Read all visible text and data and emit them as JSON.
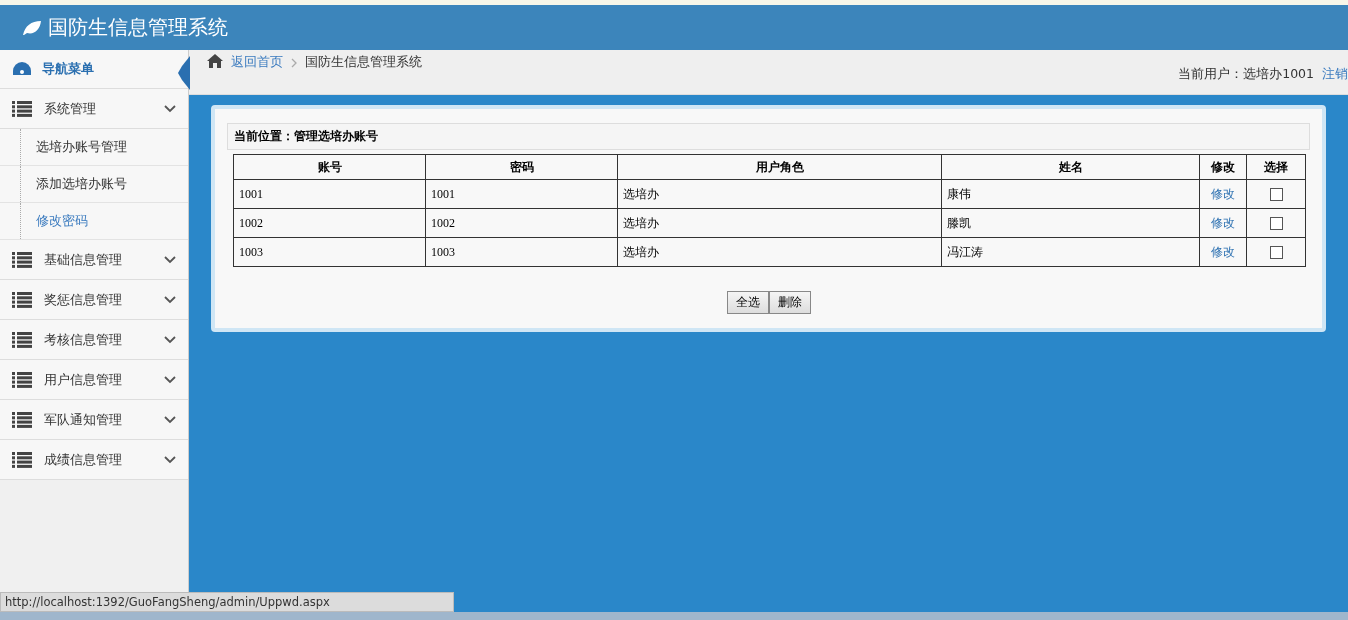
{
  "header": {
    "title": "国防生信息管理系统"
  },
  "sidebar": {
    "title": "导航菜单",
    "groups": [
      {
        "label": "系统管理",
        "children": [
          {
            "label": "选培办账号管理",
            "selected": false
          },
          {
            "label": "添加选培办账号",
            "selected": false
          },
          {
            "label": "修改密码",
            "selected": true
          }
        ]
      },
      {
        "label": "基础信息管理"
      },
      {
        "label": "奖惩信息管理"
      },
      {
        "label": "考核信息管理"
      },
      {
        "label": "用户信息管理"
      },
      {
        "label": "军队通知管理"
      },
      {
        "label": "成绩信息管理"
      }
    ]
  },
  "breadcrumb": {
    "home_link": "返回首页",
    "current": "国防生信息管理系统"
  },
  "user": {
    "label": "当前用户：选培办1001",
    "logout": "注销"
  },
  "panel": {
    "location": "当前位置：管理选培办账号",
    "table": {
      "columns": [
        "账号",
        "密码",
        "用户角色",
        "姓名",
        "修改",
        "选择"
      ],
      "rows": [
        {
          "account": "1001",
          "password": "1001",
          "role": "选培办",
          "name": "康伟",
          "edit": "修改",
          "checked": false
        },
        {
          "account": "1002",
          "password": "1002",
          "role": "选培办",
          "name": "滕凯",
          "edit": "修改",
          "checked": false
        },
        {
          "account": "1003",
          "password": "1003",
          "role": "选培办",
          "name": "冯江涛",
          "edit": "修改",
          "checked": false
        }
      ]
    },
    "buttons": [
      "全选",
      "删除"
    ]
  },
  "status_bar": {
    "url": "http://localhost:1392/GuoFangSheng/admin/Uppwd.aspx"
  }
}
